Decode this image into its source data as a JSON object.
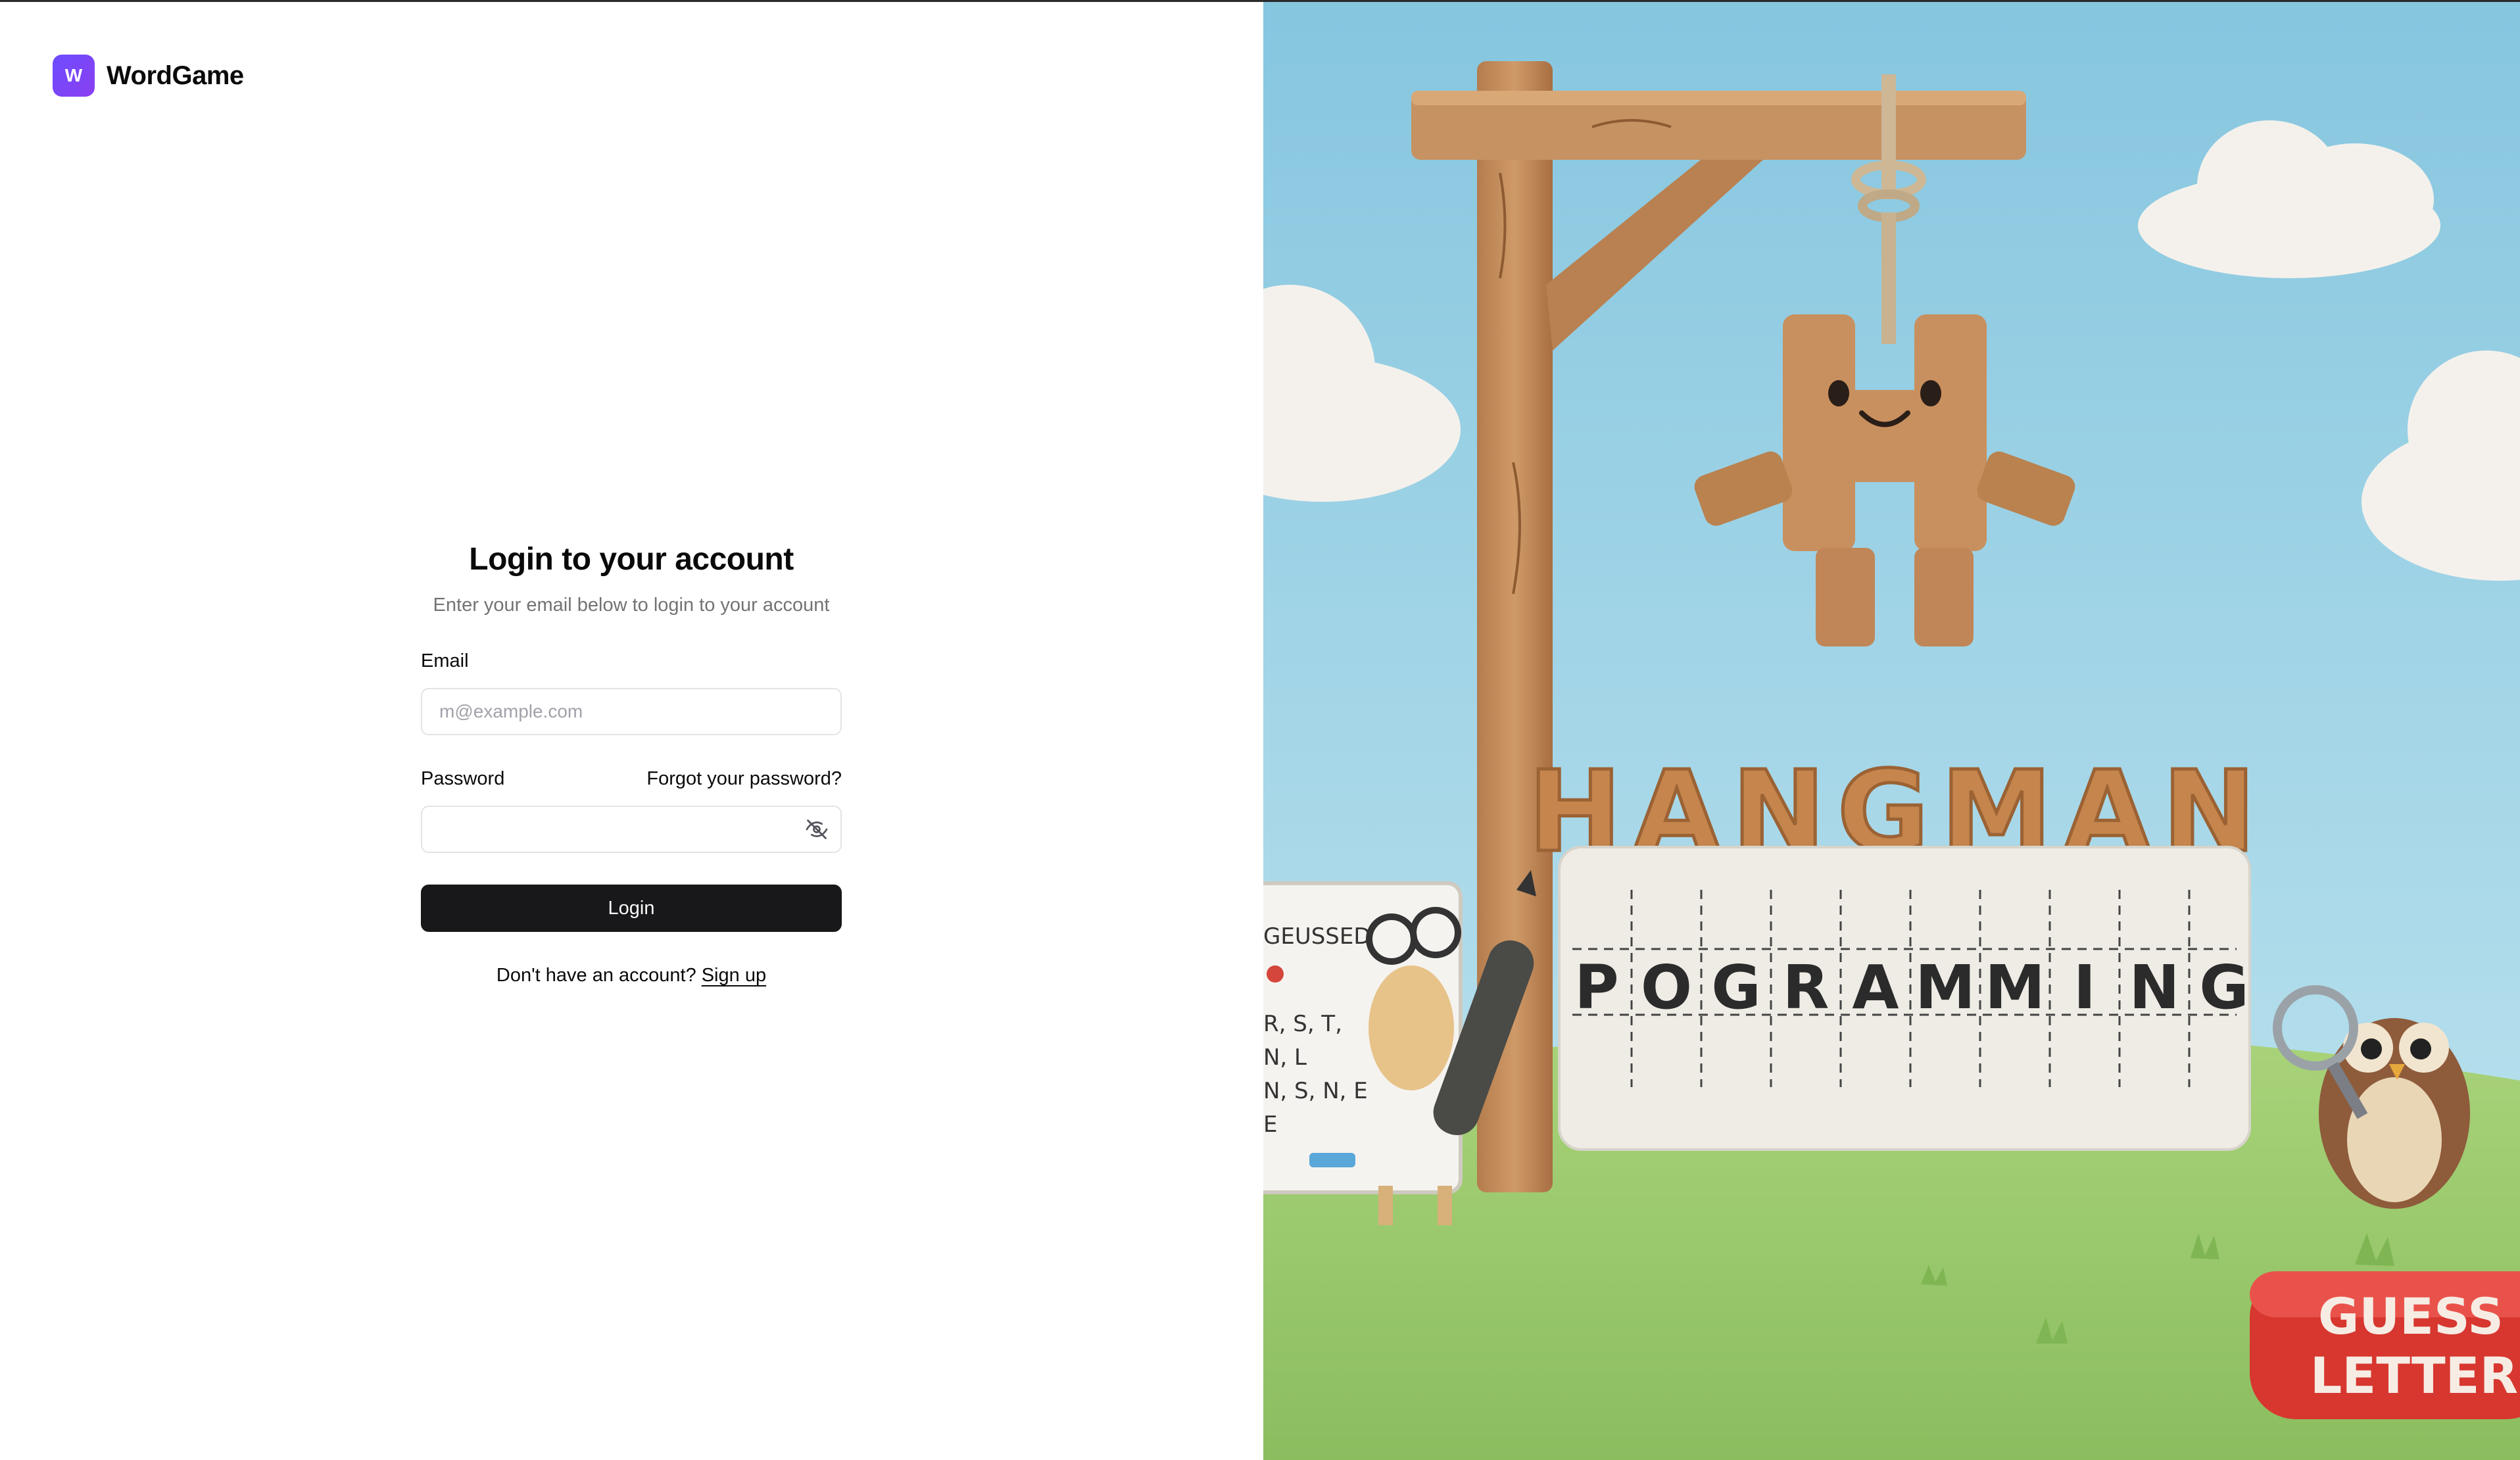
{
  "brand": {
    "logo_letter": "W",
    "name": "WordGame"
  },
  "login": {
    "title": "Login to your account",
    "subtitle": "Enter your email below to login to your account",
    "email_label": "Email",
    "email_placeholder": "m@example.com",
    "email_value": "",
    "password_label": "Password",
    "forgot_link": "Forgot your password?",
    "password_value": "",
    "submit_label": "Login",
    "signup_prompt": "Don't have an account?",
    "signup_link": "Sign up"
  },
  "hero": {
    "game_title": "HANGMAN",
    "word_letters": [
      "P",
      "O",
      "G",
      "R",
      "A",
      "M",
      "M",
      "I",
      "N",
      "G"
    ],
    "board_heading": "GEUSSED",
    "board_lines": [
      "R, S, T,",
      "N, L",
      "N, S, N, E",
      "E"
    ],
    "button_line1": "GUESS",
    "button_line2": "LETTER"
  },
  "colors": {
    "brand_accent": "#7048f5",
    "primary_button": "#18181b",
    "sky": "#9fd4e8",
    "grass": "#9ccc6e",
    "wood": "#c48e5c",
    "guess_button": "#d93a35"
  },
  "icons": {
    "password_toggle": "eye-off-icon"
  }
}
